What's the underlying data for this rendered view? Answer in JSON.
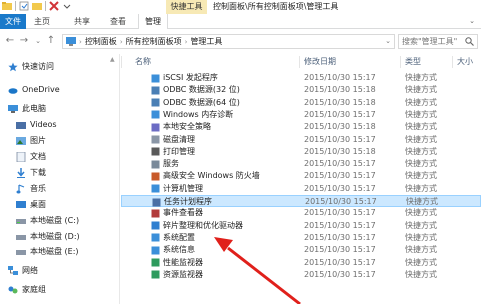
{
  "window": {
    "title": "控制面板\\所有控制面板项\\管理工具",
    "contextual_tab_group": "快捷工具"
  },
  "ribbon": {
    "tabs": [
      {
        "label": "文件"
      },
      {
        "label": "主页"
      },
      {
        "label": "共享"
      },
      {
        "label": "查看"
      },
      {
        "label": "管理"
      }
    ]
  },
  "address": {
    "crumbs": [
      "控制面板",
      "所有控制面板项",
      "管理工具"
    ],
    "search_placeholder": "搜索\"管理工具\""
  },
  "sidebar": {
    "items": [
      {
        "label": "快速访问",
        "icon": "star-icon"
      },
      {
        "label": "OneDrive",
        "icon": "cloud-icon"
      },
      {
        "label": "此电脑",
        "icon": "computer-icon"
      },
      {
        "label": "Videos",
        "icon": "video-icon"
      },
      {
        "label": "图片",
        "icon": "picture-icon"
      },
      {
        "label": "文档",
        "icon": "document-icon"
      },
      {
        "label": "下载",
        "icon": "download-icon"
      },
      {
        "label": "音乐",
        "icon": "music-icon"
      },
      {
        "label": "桌面",
        "icon": "desktop-icon"
      },
      {
        "label": "本地磁盘 (C:)",
        "icon": "drive-icon"
      },
      {
        "label": "本地磁盘 (D:)",
        "icon": "drive-icon"
      },
      {
        "label": "本地磁盘 (E:)",
        "icon": "drive-icon"
      },
      {
        "label": "网络",
        "icon": "network-icon"
      },
      {
        "label": "家庭组",
        "icon": "homegroup-icon"
      }
    ]
  },
  "list": {
    "columns": [
      "名称",
      "修改日期",
      "类型",
      "大小"
    ],
    "rows": [
      {
        "name": "iSCSI 发起程序",
        "date": "2015/10/30 15:17",
        "type": "快捷方式"
      },
      {
        "name": "ODBC 数据源(32 位)",
        "date": "2015/10/30 15:18",
        "type": "快捷方式"
      },
      {
        "name": "ODBC 数据源(64 位)",
        "date": "2015/10/30 15:18",
        "type": "快捷方式"
      },
      {
        "name": "Windows 内存诊断",
        "date": "2015/10/30 15:17",
        "type": "快捷方式"
      },
      {
        "name": "本地安全策略",
        "date": "2015/10/30 15:18",
        "type": "快捷方式"
      },
      {
        "name": "磁盘清理",
        "date": "2015/10/30 15:17",
        "type": "快捷方式"
      },
      {
        "name": "打印管理",
        "date": "2015/10/30 15:18",
        "type": "快捷方式"
      },
      {
        "name": "服务",
        "date": "2015/10/30 15:17",
        "type": "快捷方式"
      },
      {
        "name": "高级安全 Windows 防火墙",
        "date": "2015/10/30 15:17",
        "type": "快捷方式"
      },
      {
        "name": "计算机管理",
        "date": "2015/10/30 15:17",
        "type": "快捷方式"
      },
      {
        "name": "任务计划程序",
        "date": "2015/10/30 15:17",
        "type": "快捷方式"
      },
      {
        "name": "事件查看器",
        "date": "2015/10/30 15:17",
        "type": "快捷方式"
      },
      {
        "name": "碎片整理和优化驱动器",
        "date": "2015/10/30 15:17",
        "type": "快捷方式"
      },
      {
        "name": "系统配置",
        "date": "2015/10/30 15:17",
        "type": "快捷方式"
      },
      {
        "name": "系统信息",
        "date": "2015/10/30 15:17",
        "type": "快捷方式"
      },
      {
        "name": "性能监视器",
        "date": "2015/10/30 15:17",
        "type": "快捷方式"
      },
      {
        "name": "资源监视器",
        "date": "2015/10/30 15:17",
        "type": "快捷方式"
      }
    ],
    "selected_row": "任务计划程序"
  },
  "annotation": {
    "arrow_color": "#e0201b"
  }
}
